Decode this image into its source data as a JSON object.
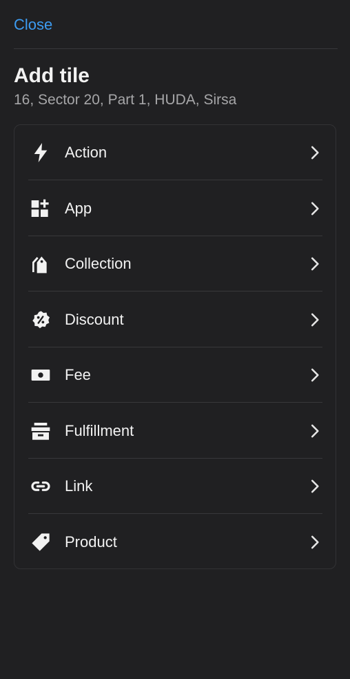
{
  "header": {
    "close_label": "Close",
    "title": "Add tile",
    "subtitle": "16, Sector 20, Part 1, HUDA, Sirsa"
  },
  "colors": {
    "background": "#202022",
    "accent": "#3d9cf2",
    "text": "#f2f2f2",
    "muted_text": "#a6a6a8"
  },
  "tile_types": [
    {
      "label": "Action",
      "icon": "lightning-bolt-icon"
    },
    {
      "label": "App",
      "icon": "apps-grid-icon"
    },
    {
      "label": "Collection",
      "icon": "collection-tags-icon"
    },
    {
      "label": "Discount",
      "icon": "discount-badge-icon"
    },
    {
      "label": "Fee",
      "icon": "cash-icon"
    },
    {
      "label": "Fulfillment",
      "icon": "fulfillment-box-icon"
    },
    {
      "label": "Link",
      "icon": "link-icon"
    },
    {
      "label": "Product",
      "icon": "price-tag-icon"
    }
  ]
}
